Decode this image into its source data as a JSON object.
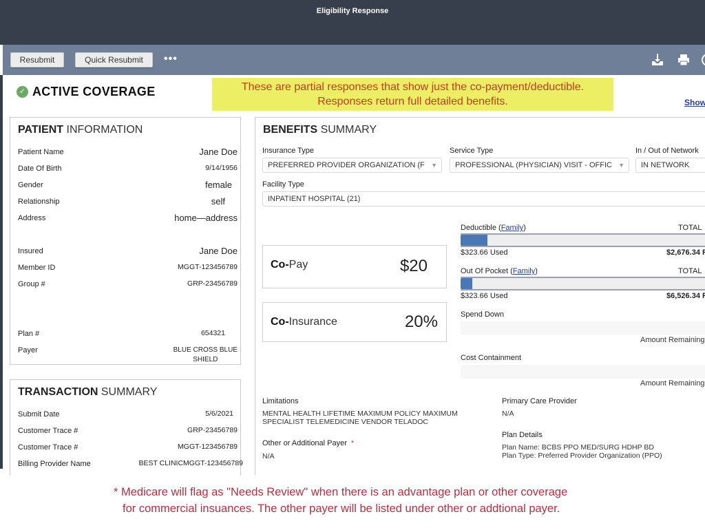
{
  "window": {
    "title": "Eligibility Response"
  },
  "toolbar": {
    "resubmit_label": "Resubmit",
    "quick_resubmit_label": "Quick Resubmit",
    "more_label": "•••",
    "icons": [
      "download-icon",
      "print-icon",
      "help-icon"
    ]
  },
  "status": {
    "icon": "check-circle-icon",
    "check_glyph": "✓",
    "label": "ACTIVE COVERAGE",
    "color": "#6aaa64"
  },
  "note": {
    "line1": "These are partial responses that show just the co-payment/deductible.",
    "line2": "Responses return full detailed benefits."
  },
  "show_link": "Show",
  "patient": {
    "title_bold": "PATIENT",
    "title_light": " INFORMATION",
    "rows": [
      {
        "label": "Patient Name",
        "value": "Jane Doe"
      },
      {
        "label": "Date Of Birth",
        "value": "9/14/1956"
      },
      {
        "label": "Gender",
        "value": "female"
      },
      {
        "label": "Relationship",
        "value": "self"
      },
      {
        "label": "Address",
        "value": "home—address"
      },
      {
        "label": "Insured",
        "value": "Jane Doe"
      },
      {
        "label": "Member ID",
        "value": "MGGT-123456789"
      },
      {
        "label": "Group #",
        "value": "GRP-23456789"
      },
      {
        "label": "Plan #",
        "value": "654321"
      },
      {
        "label": "Payer",
        "value": "BLUE CROSS BLUE",
        "value2": "SHIELD"
      }
    ]
  },
  "transaction": {
    "title_bold": "TRANSACTION",
    "title_light": " SUMMARY",
    "rows": [
      {
        "label": "Submit Date",
        "value": "5/6/2021"
      },
      {
        "label": "Customer Trace #",
        "value": "GRP-23456789"
      },
      {
        "label": "Customer Trace #",
        "value": "MGGT-123456789"
      },
      {
        "label": "Billing Provider Name",
        "value": "BEST CLINICMGGT-123456789"
      }
    ]
  },
  "benefits": {
    "title_bold": "BENEFITS",
    "title_light": " SUMMARY",
    "insurance_type": {
      "label": "Insurance Type",
      "value": "PREFERRED PROVIDER ORGANIZATION (F"
    },
    "service_type": {
      "label": "Service Type",
      "value": "PROFESSIONAL (PHYSICIAN) VISIT - OFFIC"
    },
    "network": {
      "label": "In / Out of Network",
      "value": "IN NETWORK"
    },
    "facility_type": {
      "label": "Facility Type",
      "value": "INPATIENT HOSPITAL (21)"
    },
    "caret": "▼",
    "copay": {
      "bold": "Co-",
      "label": "Pay",
      "value": "$20"
    },
    "coinsurance": {
      "bold": "Co-",
      "label": "Insurance",
      "value": "20%"
    },
    "deductible": {
      "label": "Deductible (",
      "link": "Family",
      "label_end": ")",
      "total_label": "TOTAL",
      "used": "$323.66 Used",
      "remaining": "$2,676.34 R",
      "used_fraction": 0.108
    },
    "out_of_pocket": {
      "label": "Out Of Pocket (",
      "link": "Family",
      "label_end": ")",
      "total_label": "TOTAL",
      "used": "$323.66 Used",
      "remaining": "$6,526.34 R",
      "used_fraction": 0.047
    },
    "spend_down": {
      "label": "Spend Down",
      "amount_remaining": "Amount Remaining"
    },
    "cost_containment": {
      "label": "Cost Containment",
      "amount_remaining": "Amount Remaining"
    },
    "limitations": {
      "label": "Limitations",
      "line1": "MENTAL HEALTH LIFETIME MAXIMUM POLICY MAXIMUM",
      "line2": "SPECIALIST TELEMEDICINE VENDOR TELADOC"
    },
    "other_payer": {
      "label": "Other or Additional Payer",
      "asterisk": "*",
      "value": "N/A"
    },
    "primary_care": {
      "label": "Primary Care Provider",
      "value": "N/A"
    },
    "plan_details": {
      "label": "Plan Details",
      "line1": "Plan Name: BCBS PPO MED/SURG HDHP BD",
      "line2": "Plan Type: Preferred Provider Organization (PPO)"
    }
  },
  "footnote": {
    "line1": "* Medicare will flag as \"Needs Review\" when there is an advantage plan or other coverage",
    "line2": "for commercial insuances.  The other payer will be listed under other or addtional payer."
  }
}
